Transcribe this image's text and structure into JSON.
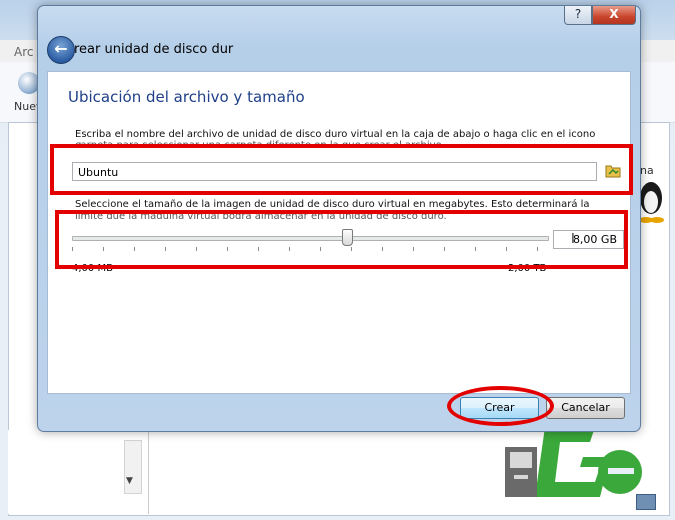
{
  "background": {
    "window_title": "Crear unidad de disco duro virtual",
    "menu_text": "Arc",
    "toolbar_new_label": "Nuev",
    "right_text": "na"
  },
  "dialog": {
    "title": "rear unidad de disco dur",
    "help_button": "?",
    "close_button": "X",
    "back_button": "←",
    "section_title": "Ubicación del archivo y tamaño",
    "file_description": "Escriba el nombre del archivo de unidad de disco duro virtual en la caja de abajo o haga clic en el icono de",
    "file_description_cont": "carpeta para seleccionar una carpeta diferente en la que crear el archivo.",
    "file_name": "Ubuntu",
    "size_description": "Seleccione el tamaño de la imagen de unidad de disco duro virtual en megabytes. Esto determinará la cantidad",
    "size_description_cont": "límite que la máquina virtual podrá almacenar en la unidad de disco duro.",
    "size_value": "8,00 GB",
    "min_label": "4,00 MB",
    "max_label": "2,00 TB",
    "create_button": "Crear",
    "cancel_button": "Cancelar"
  },
  "colors": {
    "annotation": "#e30000",
    "section_title": "#1e3f88"
  },
  "icons": [
    "back-arrow-icon",
    "folder-icon",
    "help-icon",
    "close-icon",
    "text-cursor-icon"
  ]
}
